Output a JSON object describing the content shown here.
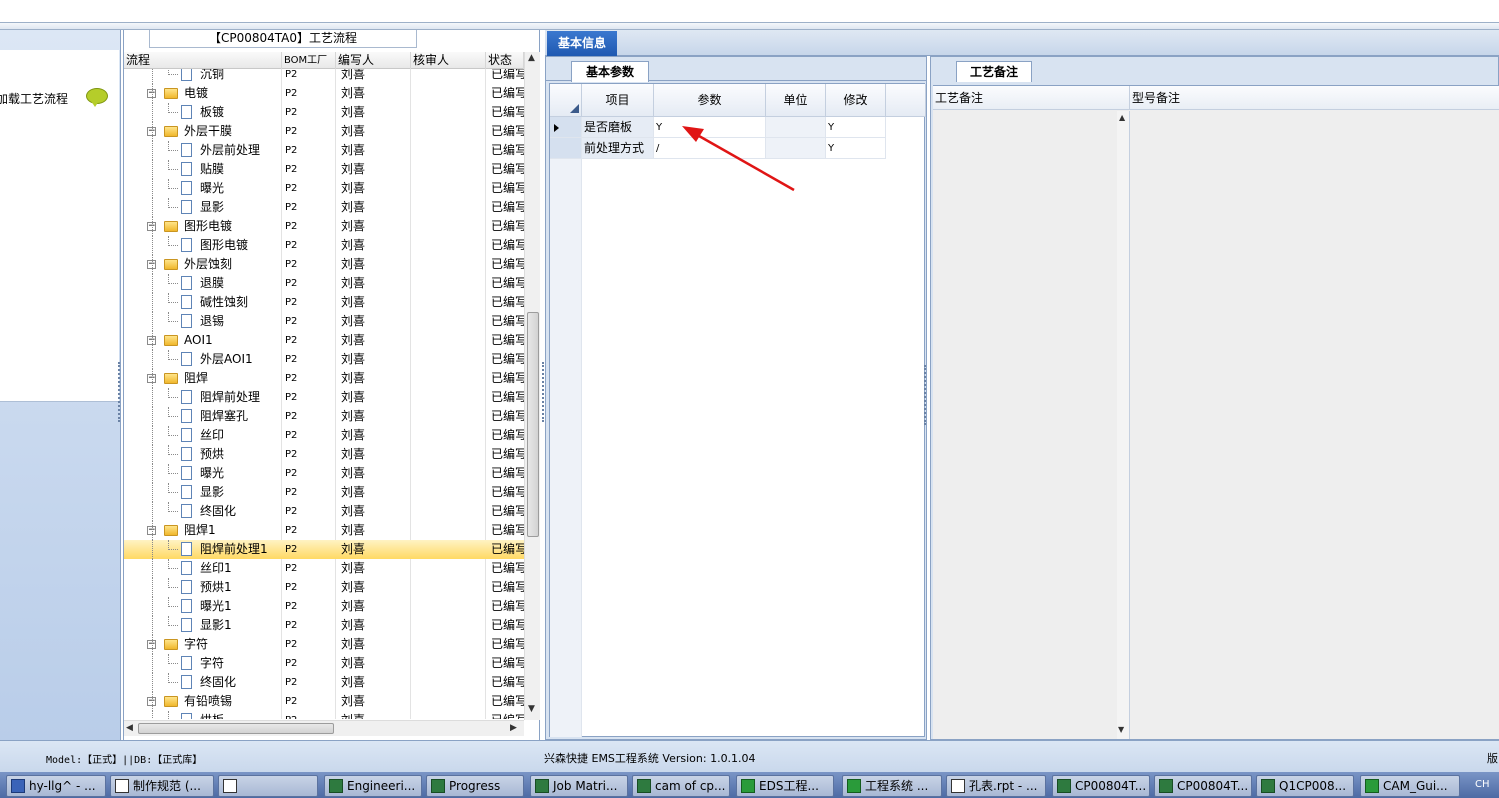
{
  "left_panel": {
    "item_label": "加载工艺流程"
  },
  "tree": {
    "title": "【CP00804TA0】工艺流程",
    "headers": [
      "流程",
      "BOM工厂",
      "编写人",
      "核审人",
      "状态"
    ],
    "rows": [
      {
        "name": "沉铜",
        "bom": "P2",
        "writer": "刘喜",
        "status": "已编写",
        "level": 2
      },
      {
        "name": "电镀",
        "bom": "P2",
        "writer": "刘喜",
        "status": "已编写",
        "level": 1
      },
      {
        "name": "板镀",
        "bom": "P2",
        "writer": "刘喜",
        "status": "已编写",
        "level": 2
      },
      {
        "name": "外层干膜",
        "bom": "P2",
        "writer": "刘喜",
        "status": "已编写",
        "level": 1
      },
      {
        "name": "外层前处理",
        "bom": "P2",
        "writer": "刘喜",
        "status": "已编写",
        "level": 2
      },
      {
        "name": "贴膜",
        "bom": "P2",
        "writer": "刘喜",
        "status": "已编写",
        "level": 2
      },
      {
        "name": "曝光",
        "bom": "P2",
        "writer": "刘喜",
        "status": "已编写",
        "level": 2
      },
      {
        "name": "显影",
        "bom": "P2",
        "writer": "刘喜",
        "status": "已编写",
        "level": 2
      },
      {
        "name": "图形电镀",
        "bom": "P2",
        "writer": "刘喜",
        "status": "已编写",
        "level": 1
      },
      {
        "name": "图形电镀",
        "bom": "P2",
        "writer": "刘喜",
        "status": "已编写",
        "level": 2
      },
      {
        "name": "外层蚀刻",
        "bom": "P2",
        "writer": "刘喜",
        "status": "已编写",
        "level": 1
      },
      {
        "name": "退膜",
        "bom": "P2",
        "writer": "刘喜",
        "status": "已编写",
        "level": 2
      },
      {
        "name": "碱性蚀刻",
        "bom": "P2",
        "writer": "刘喜",
        "status": "已编写",
        "level": 2
      },
      {
        "name": "退锡",
        "bom": "P2",
        "writer": "刘喜",
        "status": "已编写",
        "level": 2
      },
      {
        "name": "AOI1",
        "bom": "P2",
        "writer": "刘喜",
        "status": "已编写",
        "level": 1
      },
      {
        "name": "外层AOI1",
        "bom": "P2",
        "writer": "刘喜",
        "status": "已编写",
        "level": 2
      },
      {
        "name": "阻焊",
        "bom": "P2",
        "writer": "刘喜",
        "status": "已编写",
        "level": 1
      },
      {
        "name": "阻焊前处理",
        "bom": "P2",
        "writer": "刘喜",
        "status": "已编写",
        "level": 2
      },
      {
        "name": "阻焊塞孔",
        "bom": "P2",
        "writer": "刘喜",
        "status": "已编写",
        "level": 2
      },
      {
        "name": "丝印",
        "bom": "P2",
        "writer": "刘喜",
        "status": "已编写",
        "level": 2
      },
      {
        "name": "预烘",
        "bom": "P2",
        "writer": "刘喜",
        "status": "已编写",
        "level": 2
      },
      {
        "name": "曝光",
        "bom": "P2",
        "writer": "刘喜",
        "status": "已编写",
        "level": 2
      },
      {
        "name": "显影",
        "bom": "P2",
        "writer": "刘喜",
        "status": "已编写",
        "level": 2
      },
      {
        "name": "终固化",
        "bom": "P2",
        "writer": "刘喜",
        "status": "已编写",
        "level": 2
      },
      {
        "name": "阻焊1",
        "bom": "P2",
        "writer": "刘喜",
        "status": "已编写",
        "level": 1
      },
      {
        "name": "阻焊前处理1",
        "bom": "P2",
        "writer": "刘喜",
        "status": "已编写",
        "level": 2,
        "selected": true
      },
      {
        "name": "丝印1",
        "bom": "P2",
        "writer": "刘喜",
        "status": "已编写",
        "level": 2
      },
      {
        "name": "预烘1",
        "bom": "P2",
        "writer": "刘喜",
        "status": "已编写",
        "level": 2
      },
      {
        "name": "曝光1",
        "bom": "P2",
        "writer": "刘喜",
        "status": "已编写",
        "level": 2
      },
      {
        "name": "显影1",
        "bom": "P2",
        "writer": "刘喜",
        "status": "已编写",
        "level": 2
      },
      {
        "name": "字符",
        "bom": "P2",
        "writer": "刘喜",
        "status": "已编写",
        "level": 1
      },
      {
        "name": "字符",
        "bom": "P2",
        "writer": "刘喜",
        "status": "已编写",
        "level": 2
      },
      {
        "name": "终固化",
        "bom": "P2",
        "writer": "刘喜",
        "status": "已编写",
        "level": 2
      },
      {
        "name": "有铅喷锡",
        "bom": "P2",
        "writer": "刘喜",
        "status": "已编写",
        "level": 1
      },
      {
        "name": "烘板",
        "bom": "P2",
        "writer": "刘喜",
        "status": "已编写",
        "level": 2
      }
    ]
  },
  "main_tab": "基本信息",
  "params_panel": {
    "tab": "基本参数",
    "headers": [
      "项目",
      "参数",
      "单位",
      "修改"
    ],
    "rows": [
      {
        "item": "是否磨板",
        "param": "Y",
        "unit": "",
        "modify": "Y"
      },
      {
        "item": "前处理方式",
        "param": "/",
        "unit": "",
        "modify": "Y"
      }
    ]
  },
  "notes_panel": {
    "tab": "工艺备注",
    "headers": [
      "工艺备注",
      "型号备注"
    ]
  },
  "status_bar": {
    "model_text": "Model:【正式】||DB:【正式库】",
    "version_text": "兴森快捷 EMS工程系统 Version: 1.0.1.04",
    "right_text": "版"
  },
  "taskbar": {
    "items": [
      "hy-llg^ - ...",
      "制作规范 (...",
      "",
      "Engineeri...",
      "Progress",
      "Job Matri...",
      "cam of cp...",
      "EDS工程...",
      "工程系统 ...",
      "孔表.rpt - ...",
      "CP00804T...",
      "CP00804T...",
      "Q1CP008...",
      "CAM_Gui..."
    ],
    "tray_text": "CH"
  },
  "colors": {
    "accent": "#1f59b1",
    "selected_row": "#ffd964",
    "annotation_arrow": "#e01515"
  }
}
